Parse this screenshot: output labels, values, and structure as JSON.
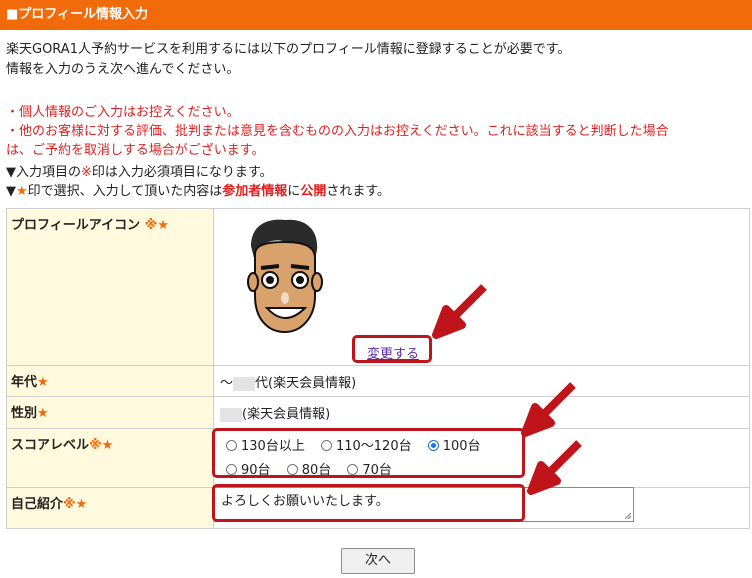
{
  "header": {
    "title": "■プロフィール情報入力"
  },
  "intro": {
    "line1": "楽天GORA1人予約サービスを利用するには以下のプロフィール情報に登録することが必要です。",
    "line2": "情報を入力のうえ次へ進んでください。"
  },
  "warnings": {
    "line1": "・個人情報のご入力はお控えください。",
    "line2": "・他のお客様に対する評価、批判または意見を含むものの入力はお控えください。これに該当すると判断した場合",
    "line3": "は、ご予約を取消しする場合がございます。"
  },
  "notes": {
    "required_prefix": "▼入力項目の",
    "required_mark": "※",
    "required_suffix": "印は入力必須項目になります。",
    "public_prefix": "▼",
    "public_mark": "★",
    "public_mid1": "印で選択、入力して頂いた内容は",
    "public_bold1": "参加者情報",
    "public_mid2": "に",
    "public_bold2": "公開",
    "public_suffix": "されます。"
  },
  "marks": {
    "req": "※",
    "pub": "★"
  },
  "form": {
    "icon_label": "プロフィールアイコン",
    "change_link": "変更する",
    "age_label": "年代",
    "age_prefix": "～",
    "age_suffix": "代(楽天会員情報)",
    "gender_label": "性別",
    "gender_suffix": "(楽天会員情報)",
    "score_label": "スコアレベル",
    "score_options": [
      {
        "label": "130台以上",
        "selected": false
      },
      {
        "label": "110～120台",
        "selected": false
      },
      {
        "label": "100台",
        "selected": true
      },
      {
        "label": "90台",
        "selected": false
      },
      {
        "label": "80台",
        "selected": false
      },
      {
        "label": "70台",
        "selected": false
      }
    ],
    "intro_label": "自己紹介",
    "intro_value": "よろしくお願いいたします。"
  },
  "next_button": "次へ",
  "colors": {
    "header": "#f26b0a",
    "warning": "#e02020",
    "highlight": "#c0141b",
    "label_bg": "#fff9dd"
  }
}
